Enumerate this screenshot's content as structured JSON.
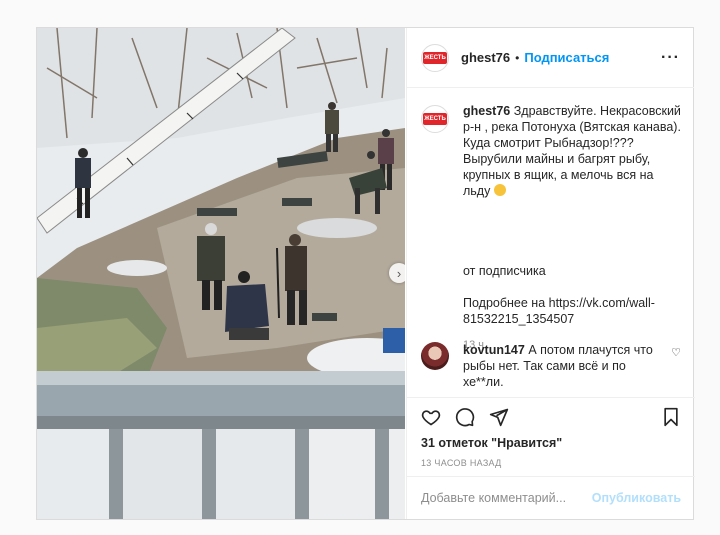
{
  "post": {
    "username": "ghest76",
    "follow_label": "Подписаться",
    "logo_text": "ЖЕСТЬ",
    "caption_username": "ghest76",
    "caption_text": "Здравствуйте. Некрасовский р-н , река Потонуха (Вятская канава). Куда смотрит Рыбнадзор!??? Вырубили майны и багрят рыбу, крупных в ящик, а мелочь вся на льду",
    "caption_source": "от подписчика",
    "caption_more": "Подробнее на https://vk.com/wall-81532215_1354507",
    "caption_time": "13 ч.",
    "comment": {
      "username": "kovtun147",
      "text": "А потом плачутся что рыбы нет. Так сами всё и по хе**ли."
    },
    "likes": "31 отметок \"Нравится\"",
    "date": "13 ЧАСОВ НАЗАД",
    "add_comment_placeholder": "Добавьте комментарий...",
    "publish_label": "Опубликовать"
  },
  "icons": {
    "more": "more-options-icon",
    "like": "heart-icon",
    "comment": "comment-icon",
    "share": "share-icon",
    "save": "bookmark-icon",
    "next": "chevron-right-icon"
  },
  "colors": {
    "follow": "#0095f6",
    "logo_red": "#e0262b",
    "publish_disabled": "#b2dffc",
    "muted": "#8e8e8e"
  }
}
